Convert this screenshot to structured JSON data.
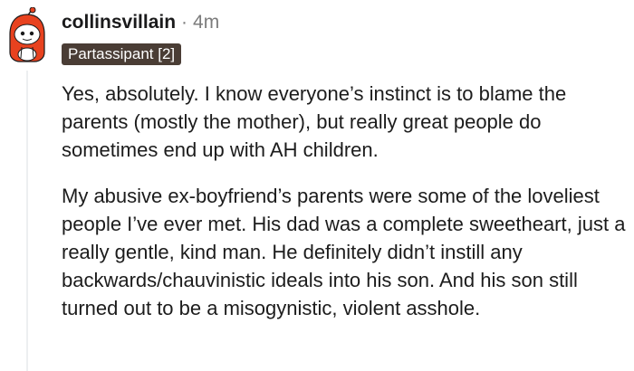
{
  "comment": {
    "username": "collinsvillain",
    "separator": "·",
    "timestamp": "4m",
    "flair": "Partassipant [2]",
    "paragraphs": [
      "Yes, absolutely. I know everyone’s instinct is to blame the parents (mostly the mother), but really great people do sometimes end up with AH children.",
      "My abusive ex-boyfriend’s parents were some of the loveliest people I’ve ever met. His dad was a complete sweetheart, just a really gentle, kind man. He definitely didn’t instill any backwards/chauvinistic ideals into his son. And his son still turned out to be a misogynistic, violent asshole."
    ]
  },
  "colors": {
    "flair_bg": "#4a3d35",
    "avatar_hood": "#e8421f",
    "thread_line": "#edeff1"
  },
  "icons": {
    "avatar": "snoo-avatar-icon"
  }
}
